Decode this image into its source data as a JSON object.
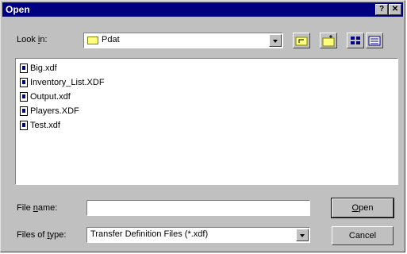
{
  "window": {
    "title": "Open",
    "help_glyph": "?",
    "close_glyph": "✕"
  },
  "look_in": {
    "label_pre": "Look ",
    "label_u": "i",
    "label_post": "n:",
    "value": "Pdat"
  },
  "toolbar": {
    "up_icon": "up-folder-icon",
    "new_folder_icon": "new-folder-icon",
    "list_icon": "list-view-icon",
    "details_icon": "details-view-icon"
  },
  "files": [
    "Big.xdf",
    "Inventory_List.XDF",
    "Output.xdf",
    "Players.XDF",
    "Test.xdf"
  ],
  "file_name": {
    "label_pre": "File ",
    "label_u": "n",
    "label_post": "ame:",
    "value": ""
  },
  "file_type": {
    "label_pre": "Files of ",
    "label_u": "t",
    "label_post": "ype:",
    "value": "Transfer Definition Files (*.xdf)"
  },
  "buttons": {
    "open_u": "O",
    "open_rest": "pen",
    "cancel": "Cancel"
  }
}
